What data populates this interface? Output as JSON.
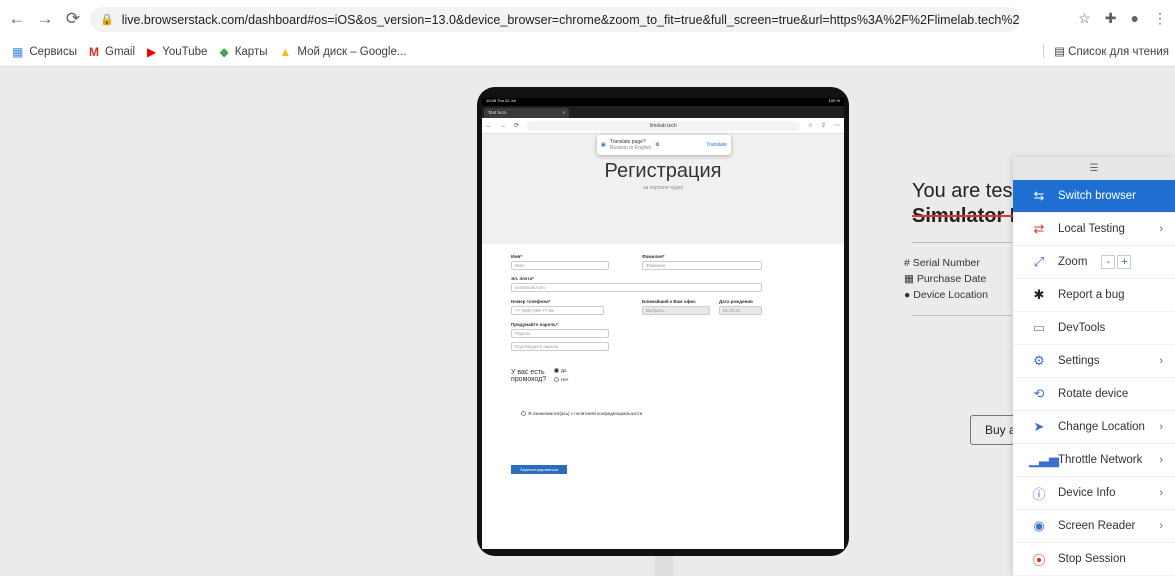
{
  "browser": {
    "url": "live.browserstack.com/dashboard#os=iOS&os_version=13.0&device_browser=chrome&zoom_to_fit=true&full_screen=true&url=https%3A%2F%2Flimelab.tech%2Ftest...",
    "bookmarks": [
      "Сервисы",
      "Gmail",
      "YouTube",
      "Карты",
      "Мой диск – Google..."
    ],
    "reading_list": "Список для чтения"
  },
  "device": {
    "status_time": "10:08  Thu 22 Jul",
    "status_battery": "100 %",
    "tab_title": "Test form",
    "site_domain": "limelab.tech",
    "translate": {
      "title": "Translate page?",
      "sub": "Russian to English",
      "button": "Translate"
    },
    "page": {
      "title": "Регистрация",
      "subtitle": "на портале чудес",
      "fields": {
        "name_label": "Имя*",
        "name_ph": "Имя",
        "surname_label": "Фамилия*",
        "surname_ph": "Фамилия",
        "email_label": "Эл. почта*",
        "email_ph": "yourEmail.com",
        "phone_label": "Номер телефона*",
        "phone_ph": "+7 (999) 999-77-66",
        "office_label": "Ближайший к Вам офис",
        "office_ph": "Выбрать...",
        "birth_label": "Дата рождения",
        "birth_ph": "01.02.21",
        "password_label": "Придумайте пароль*:",
        "password_ph": "Пароль",
        "password_confirm_ph": "Подтвердите пароль",
        "promo_label": "У вас есть промокод?",
        "promo_yes": "Да",
        "promo_no": "Нет",
        "agree": "Я ознакомился(ась) с политикой конфиденциальности",
        "submit": "Зарегистрироваться"
      }
    }
  },
  "info": {
    "title": "You are tes",
    "strike": "Simulator R",
    "serial": "Serial Number",
    "purchase": "Purchase Date",
    "location": "Device Location",
    "buy": "Buy a"
  },
  "menu": {
    "items": [
      {
        "label": "Switch browser",
        "icon": "switch-icon"
      },
      {
        "label": "Local Testing",
        "icon": "local-testing-icon"
      },
      {
        "label": "Zoom",
        "icon": "zoom-icon"
      },
      {
        "label": "Report a bug",
        "icon": "bug-icon"
      },
      {
        "label": "DevTools",
        "icon": "devtools-icon"
      },
      {
        "label": "Settings",
        "icon": "gear-icon"
      },
      {
        "label": "Rotate device",
        "icon": "rotate-icon"
      },
      {
        "label": "Change Location",
        "icon": "location-icon"
      },
      {
        "label": "Throttle Network",
        "icon": "signal-icon"
      },
      {
        "label": "Device Info",
        "icon": "info-icon"
      },
      {
        "label": "Screen Reader",
        "icon": "accessibility-icon"
      },
      {
        "label": "Stop Session",
        "icon": "stop-icon"
      }
    ],
    "zoom_minus": "-",
    "zoom_plus": "+",
    "colors": {
      "accent": "#1f6fd2",
      "stop": "#d93025"
    }
  }
}
